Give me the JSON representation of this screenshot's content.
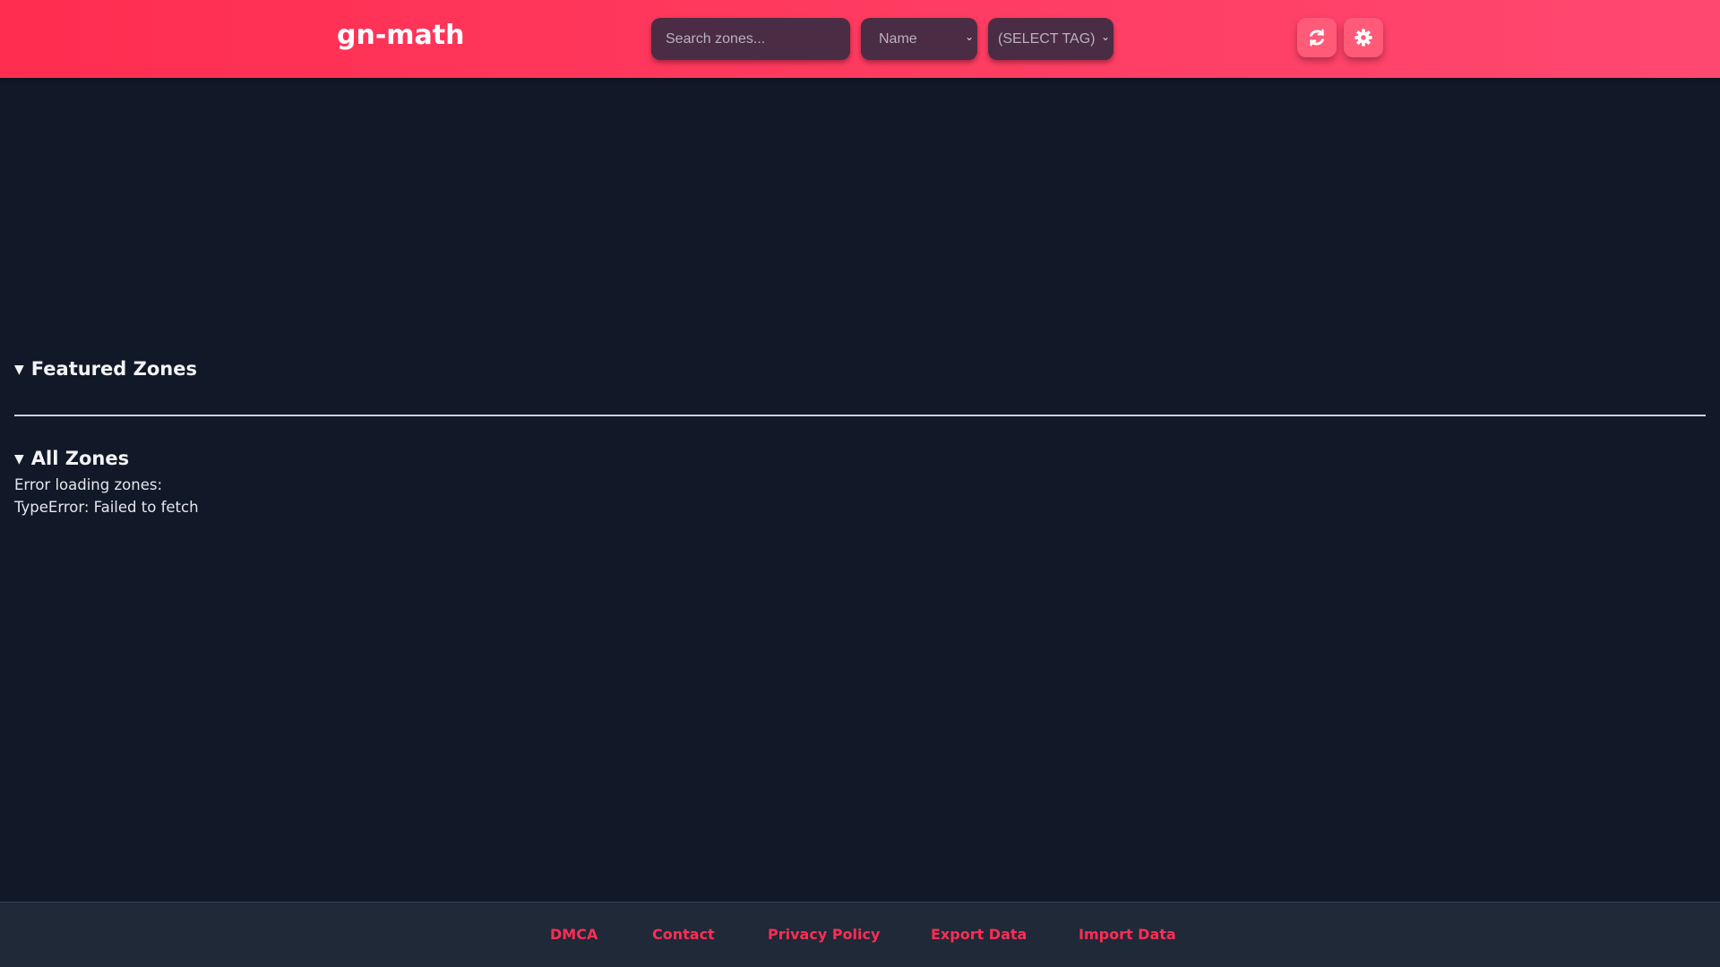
{
  "header": {
    "title": "gn-math",
    "search_placeholder": "Search zones...",
    "sort_value": "Name",
    "tag_value": "(SELECT TAG)",
    "refresh_icon": "refresh-icon",
    "settings_icon": "gear-icon"
  },
  "main": {
    "featured_label": "Featured Zones",
    "all_label": "All Zones",
    "error_line1": "Error loading zones:",
    "error_line2": "TypeError: Failed to fetch"
  },
  "footer": {
    "links": [
      "DMCA",
      "Contact",
      "Privacy Policy",
      "Export Data",
      "Import Data"
    ]
  },
  "colors": {
    "accent": "#ff2d55",
    "background": "#111827",
    "footer": "#1f2937"
  }
}
